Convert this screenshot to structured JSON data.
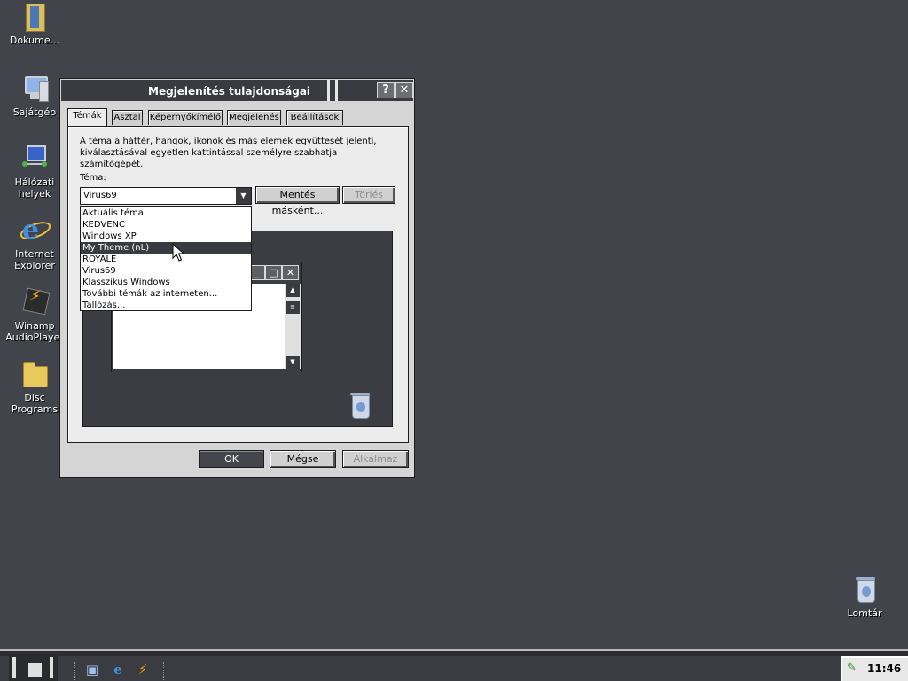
{
  "desktop": {
    "icons": [
      {
        "label": "Dokume..."
      },
      {
        "label": "Sajátgép"
      },
      {
        "label": "Hálózati helyek"
      },
      {
        "label": "Internet Explorer"
      },
      {
        "label": "Winamp AudioPlayer"
      },
      {
        "label": "Disc Programs"
      },
      {
        "label": "Lomtár"
      }
    ]
  },
  "dialog": {
    "title": "Megjelenítés tulajdonságai",
    "help_btn": "?",
    "close_btn": "✕",
    "tabs": [
      "Témák",
      "Asztal",
      "Képernyőkímélő",
      "Megjelenés",
      "Beállítások"
    ],
    "active_tab": "Témák",
    "description": "A téma a háttér, hangok, ikonok és más elemek együttesét jelenti, kiválasztásával egyetlen kattintással személyre szabhatja számítógépét.",
    "theme_label": "Téma:",
    "theme_value": "Virus69",
    "save_as_label": "Mentés másként...",
    "delete_label": "Törlés",
    "dropdown_items": [
      "Aktuális téma",
      "KEDVENC",
      "Windows XP",
      "My Theme (nL)",
      "ROYALE",
      "Virus69",
      "Klasszikus Windows",
      "További témák az interneten...",
      "Tallózás..."
    ],
    "highlighted_item": "My Theme (nL)",
    "ok_label": "OK",
    "cancel_label": "Mégse",
    "apply_label": "Alkalmaz"
  },
  "taskbar": {
    "clock": "11:46"
  },
  "colors": {
    "desktop_bg": "#42444c",
    "titlebar": "#3a3b40",
    "dialog_face": "#d5d5d5",
    "selection": "#3a3b40"
  }
}
